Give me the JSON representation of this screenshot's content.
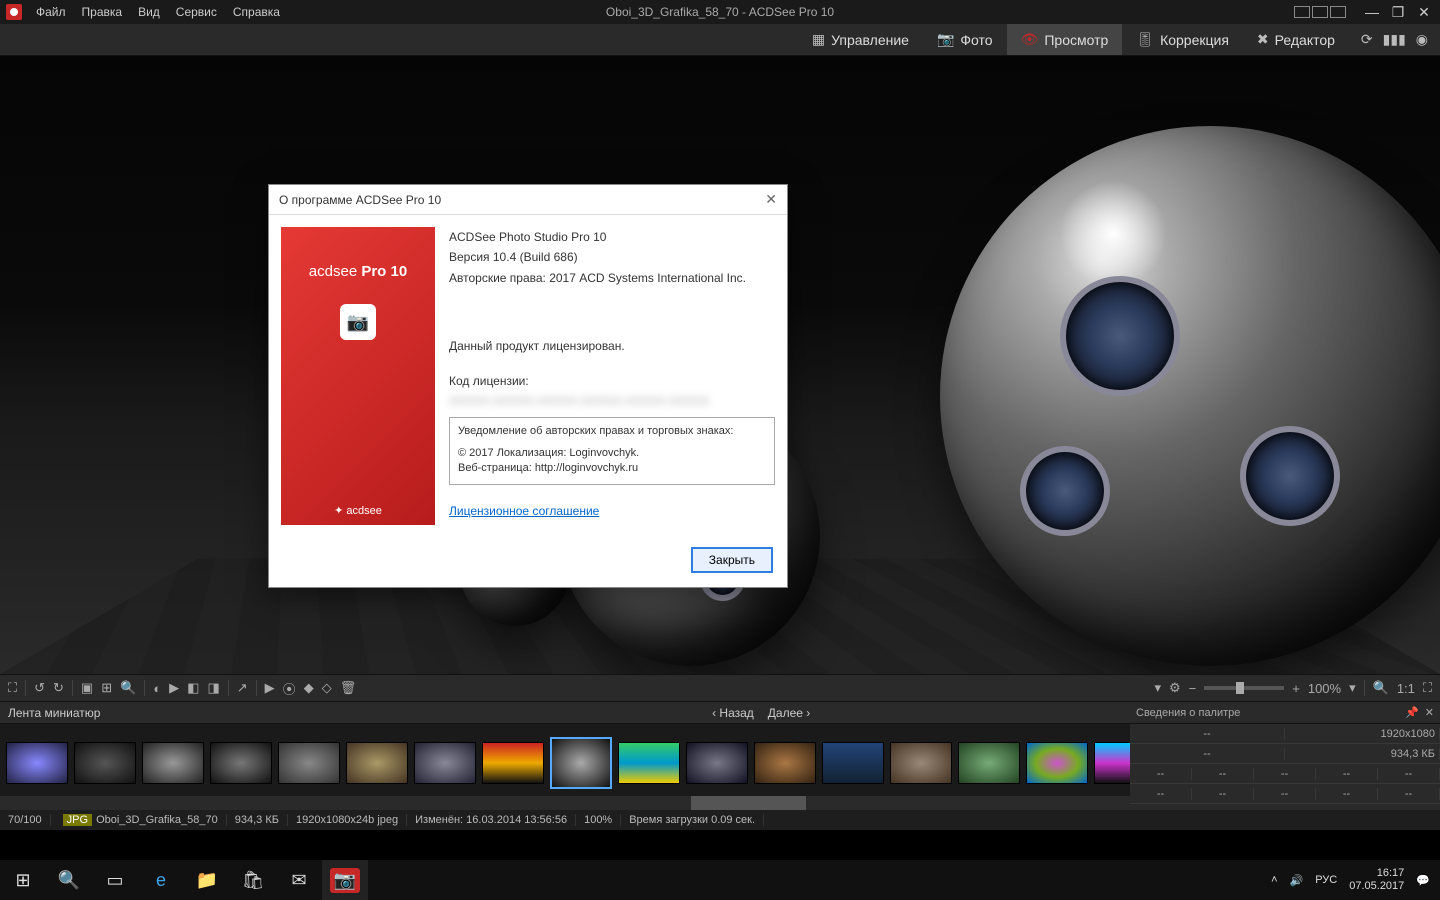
{
  "titlebar": {
    "menu": [
      "Файл",
      "Правка",
      "Вид",
      "Сервис",
      "Справка"
    ],
    "title": "Oboi_3D_Grafika_58_70 - ACDSee Pro 10"
  },
  "modes": {
    "items": [
      "Управление",
      "Фото",
      "Просмотр",
      "Коррекция",
      "Редактор"
    ],
    "active_index": 2
  },
  "toolbar": {
    "zoom": "100%",
    "ratio": "1:1"
  },
  "filmstrip": {
    "label": "Лента миниатюр",
    "back": "Назад",
    "forward": "Далее"
  },
  "palette": {
    "title": "Сведения о палитре",
    "res": "1920x1080",
    "size": "934,3 КБ",
    "dash": "--"
  },
  "status": {
    "pos": "70/100",
    "fmt": "JPG",
    "name": "Oboi_3D_Grafika_58_70",
    "size": "934,3 КБ",
    "dims": "1920x1080x24b jpeg",
    "modified": "Изменён: 16.03.2014 13:56:56",
    "zoom": "100%",
    "loadtime": "Время загрузки 0.09 сек."
  },
  "dialog": {
    "title": "О программе ACDSee Pro 10",
    "brand_prefix": "acdsee",
    "brand_suffix": "Pro 10",
    "brand_footer": "✦ acdsee",
    "product": "ACDSee Photo Studio Pro 10",
    "version": "Версия 10.4 (Build 686)",
    "copyright": "Авторские права: 2017 ACD Systems International Inc.",
    "licensed": "Данный продукт лицензирован.",
    "license_label": "Код лицензии:",
    "license_key_blur": "XXXXX-XXXXX-XXXXX-XXXXX-XXXXX-XXXXX",
    "notice_heading": "Уведомление об авторских правах и торговых знаках:",
    "notice_line1": "© 2017 Локализация: Loginvovchyk.",
    "notice_line2": "Веб-страница: http://loginvovchyk.ru",
    "agreement": "Лицензионное соглашение",
    "close": "Закрыть"
  },
  "taskbar": {
    "lang": "РУС",
    "time": "16:17",
    "date": "07.05.2017"
  }
}
